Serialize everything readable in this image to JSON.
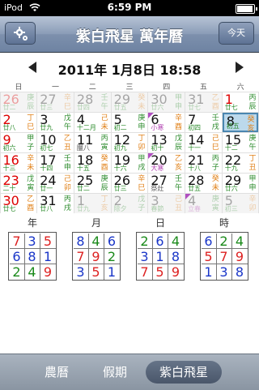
{
  "status_bar": {
    "carrier": "iPod",
    "time": "6:59 PM"
  },
  "nav": {
    "title": "紫白飛星 萬年曆",
    "today_label": "今天"
  },
  "date_header": {
    "text": "2011年 1月8日 18:58"
  },
  "weekdays": [
    "日",
    "一",
    "二",
    "三",
    "四",
    "五",
    "六"
  ],
  "calendar": [
    [
      {
        "n": "26",
        "s": "廿二",
        "g": [
          "庚",
          "辰"
        ],
        "o": true
      },
      {
        "n": "27",
        "s": "廿三",
        "g": [
          "辛",
          "巳"
        ],
        "o": true
      },
      {
        "n": "28",
        "s": "廿四",
        "g": [
          "壬",
          "午"
        ],
        "o": true
      },
      {
        "n": "29",
        "s": "廿五",
        "g": [
          "癸",
          "未"
        ],
        "o": true
      },
      {
        "n": "30",
        "s": "廿六",
        "g": [
          "甲",
          "申"
        ],
        "o": true
      },
      {
        "n": "31",
        "s": "廿七",
        "g": [
          "乙",
          "酉"
        ],
        "o": true
      },
      {
        "n": "1",
        "s": "廿七",
        "g": [
          "丙",
          "辰"
        ],
        "o": false
      }
    ],
    [
      {
        "n": "2",
        "s": "廿八",
        "g": [
          "丁",
          "巳"
        ],
        "o": false
      },
      {
        "n": "3",
        "s": "廿九",
        "g": [
          "戊",
          "午"
        ],
        "o": false
      },
      {
        "n": "4",
        "s": "十二月",
        "g": [
          "己",
          "未"
        ],
        "o": false
      },
      {
        "n": "5",
        "s": "初二",
        "g": [
          "庚",
          "申"
        ],
        "o": false
      },
      {
        "n": "6",
        "s": "小寒",
        "g": [
          "辛",
          "酉"
        ],
        "o": false,
        "t": "term",
        "f": true
      },
      {
        "n": "7",
        "s": "初四",
        "g": [
          "壬",
          "戌"
        ],
        "o": false
      },
      {
        "n": "8",
        "s": "初五",
        "g": [
          "癸",
          "亥"
        ],
        "o": false,
        "sel": true
      }
    ],
    [
      {
        "n": "9",
        "s": "初六",
        "g": [
          "甲",
          "子"
        ],
        "o": false
      },
      {
        "n": "10",
        "s": "初七",
        "g": [
          "乙",
          "丑"
        ],
        "o": false
      },
      {
        "n": "11",
        "s": "臘八",
        "g": [
          "丙",
          "寅"
        ],
        "o": false,
        "t": "fest"
      },
      {
        "n": "12",
        "s": "初九",
        "g": [
          "丁",
          "卯"
        ],
        "o": false
      },
      {
        "n": "13",
        "s": "初十",
        "g": [
          "戊",
          "辰"
        ],
        "o": false
      },
      {
        "n": "14",
        "s": "十一",
        "g": [
          "己",
          "巳"
        ],
        "o": false
      },
      {
        "n": "15",
        "s": "十二",
        "g": [
          "庚",
          "午"
        ],
        "o": false
      }
    ],
    [
      {
        "n": "16",
        "s": "十三",
        "g": [
          "辛",
          "未"
        ],
        "o": false
      },
      {
        "n": "17",
        "s": "十四",
        "g": [
          "壬",
          "申"
        ],
        "o": false
      },
      {
        "n": "18",
        "s": "十五",
        "g": [
          "癸",
          "酉"
        ],
        "o": false
      },
      {
        "n": "19",
        "s": "十六",
        "g": [
          "甲",
          "戌"
        ],
        "o": false
      },
      {
        "n": "20",
        "s": "大寒",
        "g": [
          "乙",
          "亥"
        ],
        "o": false,
        "t": "term",
        "f": true
      },
      {
        "n": "21",
        "s": "十八",
        "g": [
          "丙",
          "子"
        ],
        "o": false
      },
      {
        "n": "22",
        "s": "十九",
        "g": [
          "丁",
          "丑"
        ],
        "o": false
      }
    ],
    [
      {
        "n": "23",
        "s": "二十",
        "g": [
          "戊",
          "寅"
        ],
        "o": false
      },
      {
        "n": "24",
        "s": "廿一",
        "g": [
          "己",
          "卯"
        ],
        "o": false
      },
      {
        "n": "25",
        "s": "廿二",
        "g": [
          "庚",
          "辰"
        ],
        "o": false
      },
      {
        "n": "26",
        "s": "廿三",
        "g": [
          "辛",
          "巳"
        ],
        "o": false
      },
      {
        "n": "27",
        "s": "祭灶",
        "g": [
          "壬",
          "午"
        ],
        "o": false,
        "t": "fest"
      },
      {
        "n": "28",
        "s": "廿五",
        "g": [
          "癸",
          "未"
        ],
        "o": false
      },
      {
        "n": "29",
        "s": "廿六",
        "g": [
          "甲",
          "申"
        ],
        "o": false
      }
    ],
    [
      {
        "n": "30",
        "s": "廿七",
        "g": [
          "乙",
          "酉"
        ],
        "o": false
      },
      {
        "n": "31",
        "s": "廿八",
        "g": [
          "丙",
          "戌"
        ],
        "o": false
      },
      {
        "n": "1",
        "s": "廿九",
        "g": [
          "丁",
          "亥"
        ],
        "o": true
      },
      {
        "n": "2",
        "s": "除夕",
        "g": [
          "戊",
          "子"
        ],
        "o": true
      },
      {
        "n": "3",
        "s": "春節",
        "g": [
          "己",
          "丑"
        ],
        "o": true
      },
      {
        "n": "4",
        "s": "立春",
        "g": [
          "庚",
          "寅"
        ],
        "o": true,
        "t": "term",
        "f": true
      },
      {
        "n": "5",
        "s": "初三",
        "g": [
          "辛",
          "卯"
        ],
        "o": true
      }
    ]
  ],
  "fly_stars": [
    {
      "label": "年",
      "grid": [
        [
          "7",
          "3",
          "5"
        ],
        [
          "6",
          "8",
          "1"
        ],
        [
          "2",
          "4",
          "9"
        ]
      ]
    },
    {
      "label": "月",
      "grid": [
        [
          "8",
          "4",
          "6"
        ],
        [
          "7",
          "9",
          "2"
        ],
        [
          "3",
          "5",
          "1"
        ]
      ]
    },
    {
      "label": "日",
      "grid": [
        [
          "2",
          "6",
          "4"
        ],
        [
          "3",
          "1",
          "8"
        ],
        [
          "7",
          "5",
          "9"
        ]
      ]
    },
    {
      "label": "時",
      "grid": [
        [
          "6",
          "2",
          "4"
        ],
        [
          "5",
          "7",
          "9"
        ],
        [
          "1",
          "3",
          "8"
        ]
      ]
    }
  ],
  "star_colors": {
    "1": "#1a36c8",
    "2": "#1a8a1a",
    "3": "#1a36c8",
    "4": "#1a8a1a",
    "5": "#d22",
    "6": "#1a36c8",
    "7": "#d22",
    "8": "#1a36c8",
    "9": "#d22"
  },
  "tabs": [
    "農曆",
    "假期",
    "紫白飛星"
  ],
  "active_tab": "紫白飛星"
}
